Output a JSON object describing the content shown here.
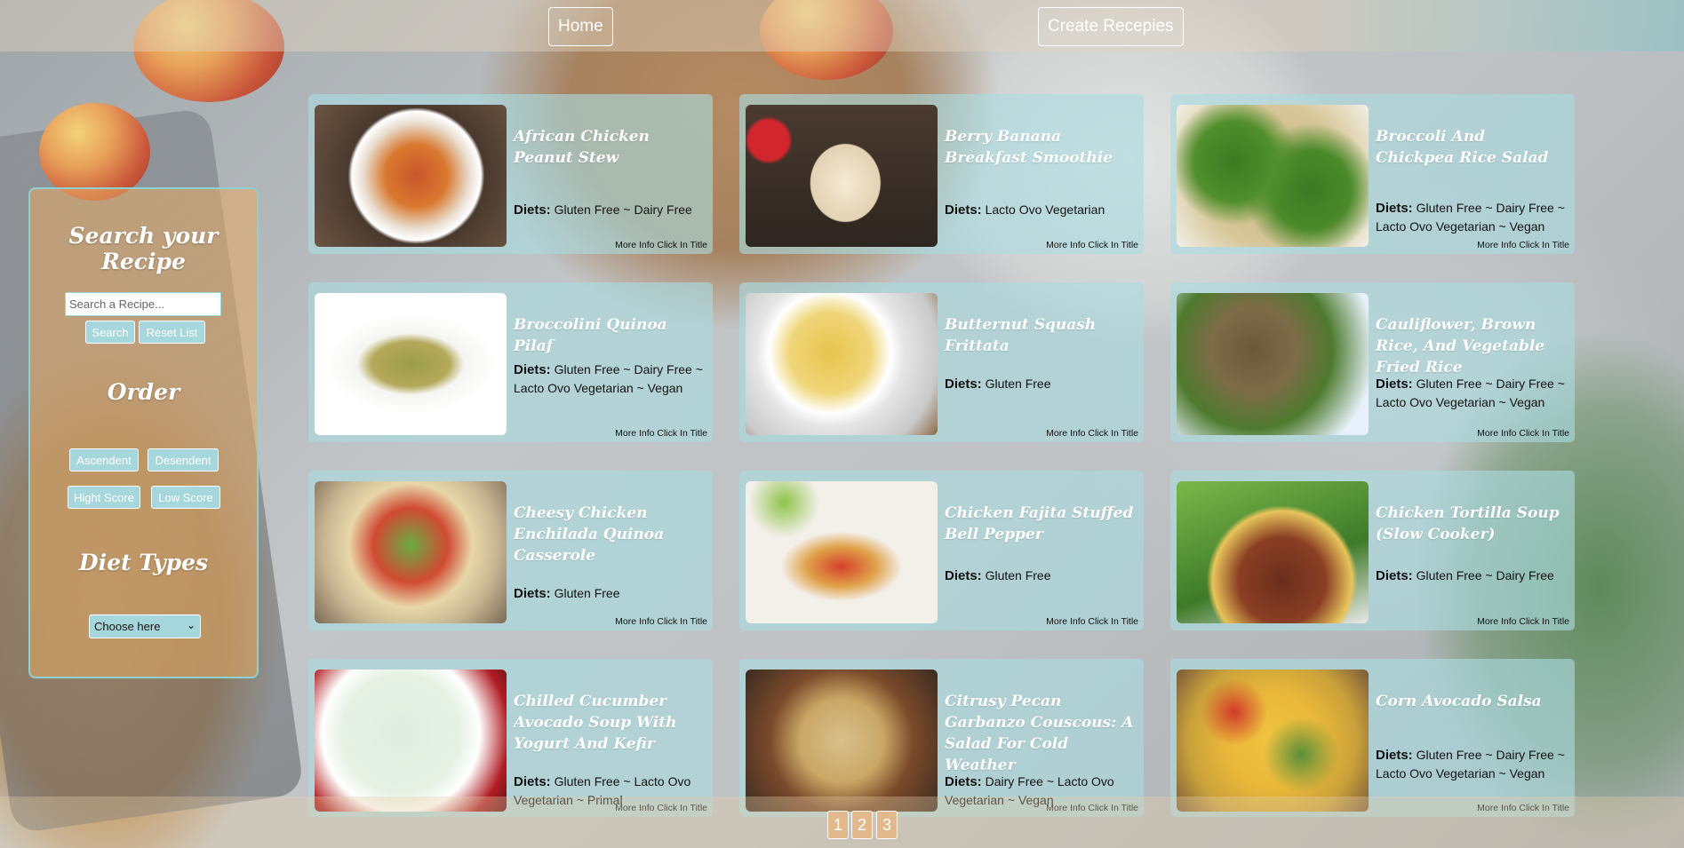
{
  "nav": {
    "home_label": "Home",
    "create_label": "Create Recepies"
  },
  "sidebar": {
    "search_title": "Search your Recipe",
    "search_placeholder": "Search a Recipe...",
    "search_button": "Search",
    "reset_button": "Reset List",
    "order_title": "Order",
    "ascendent_button": "Ascendent",
    "desendent_button": "Desendent",
    "high_score_button": "Hight Score",
    "low_score_button": "Low Score",
    "diet_title": "Diet Types",
    "diet_select_value": "Choose here"
  },
  "colors": {
    "card_tint": "#aadce1",
    "accent_teal": "#a6d7dc",
    "sidebar_tint": "#e6aa64",
    "page_button": "#e2b98c"
  },
  "diets_label": "Diets:",
  "more_info_label": "More Info Click In Title",
  "recipes": [
    {
      "title": "African Chicken Peanut Stew",
      "diets": "Gluten Free ~ Dairy Free",
      "image": "peanut-stew-bowl"
    },
    {
      "title": "Berry Banana Breakfast Smoothie",
      "diets": "Lacto Ovo Vegetarian",
      "image": "berry-smoothie-glass"
    },
    {
      "title": "Broccoli And Chickpea Rice Salad",
      "diets": "Gluten Free ~ Dairy Free ~ Lacto Ovo Vegetarian ~ Vegan",
      "image": "broccoli-chickpea-salad"
    },
    {
      "title": "Broccolini Quinoa Pilaf",
      "diets": "Gluten Free ~ Dairy Free ~ Lacto Ovo Vegetarian ~ Vegan",
      "image": "quinoa-pilaf-plate"
    },
    {
      "title": "Butternut Squash Frittata",
      "diets": "Gluten Free",
      "image": "frittata-ramekin"
    },
    {
      "title": "Cauliflower, Brown Rice, And Vegetable Fried Rice",
      "diets": "Gluten Free ~ Dairy Free ~ Lacto Ovo Vegetarian ~ Vegan",
      "image": "fried-rice-peas"
    },
    {
      "title": "Cheesy Chicken Enchilada Quinoa Casserole",
      "diets": "Gluten Free",
      "image": "enchilada-casserole"
    },
    {
      "title": "Chicken Fajita Stuffed Bell Pepper",
      "diets": "Gluten Free",
      "image": "stuffed-peppers"
    },
    {
      "title": "Chicken Tortilla Soup (Slow Cooker)",
      "diets": "Gluten Free ~ Dairy Free",
      "image": "tortilla-soup-bowl"
    },
    {
      "title": "Chilled Cucumber Avocado Soup With Yogurt And Kefir",
      "diets": "Gluten Free ~ Lacto Ovo Vegetarian ~ Primal",
      "image": "cucumber-soup-bowl"
    },
    {
      "title": "Citrusy Pecan Garbanzo Couscous: A Salad For Cold Weather",
      "diets": "Dairy Free ~ Lacto Ovo Vegetarian ~ Vegan",
      "image": "couscous-salad"
    },
    {
      "title": "Corn Avocado Salsa",
      "diets": "Gluten Free ~ Dairy Free ~ Lacto Ovo Vegetarian ~ Vegan",
      "image": "corn-avocado-salsa"
    }
  ],
  "pagination": [
    "1",
    "2",
    "3"
  ]
}
